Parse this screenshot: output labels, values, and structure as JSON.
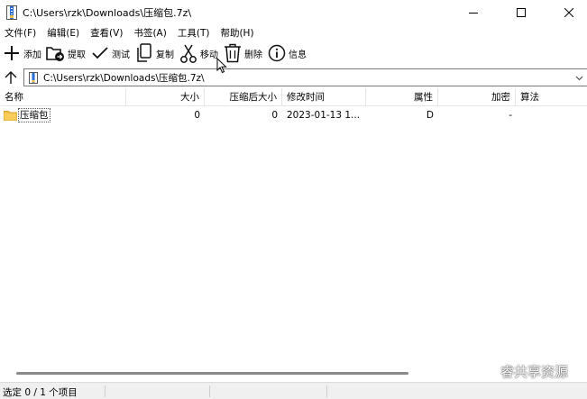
{
  "window": {
    "title": "C:\\Users\\rzk\\Downloads\\压缩包.7z\\"
  },
  "menu": [
    {
      "label": "文件(F)"
    },
    {
      "label": "编辑(E)"
    },
    {
      "label": "查看(V)"
    },
    {
      "label": "书签(A)"
    },
    {
      "label": "工具(T)"
    },
    {
      "label": "帮助(H)"
    }
  ],
  "toolbar": [
    {
      "label": "添加",
      "icon": "plus-icon"
    },
    {
      "label": "提取",
      "icon": "extract-folder-icon"
    },
    {
      "label": "测试",
      "icon": "checkmark-icon"
    },
    {
      "label": "复制",
      "icon": "copy-icon"
    },
    {
      "label": "移动",
      "icon": "scissors-icon"
    },
    {
      "label": "删除",
      "icon": "trash-icon"
    },
    {
      "label": "信息",
      "icon": "info-icon"
    }
  ],
  "address": {
    "path": "C:\\Users\\rzk\\Downloads\\压缩包.7z\\"
  },
  "columns": {
    "name": "名称",
    "size": "大小",
    "packed": "压缩后大小",
    "modified": "修改时间",
    "attributes": "属性",
    "encrypted": "加密",
    "method": "算法"
  },
  "rows": [
    {
      "name": "压缩包",
      "size": "0",
      "packed": "0",
      "modified": "2023-01-13 1...",
      "attributes": "D",
      "encrypted": "-",
      "method": ""
    }
  ],
  "status": {
    "selection": "选定 0 / 1 个项目"
  },
  "watermark": {
    "text": "睿共享资源"
  },
  "colors": {
    "folder": "#f3c14b",
    "folder_dark": "#dca52a",
    "text": "#000000",
    "statusbar_bg": "#f0f0f0"
  }
}
